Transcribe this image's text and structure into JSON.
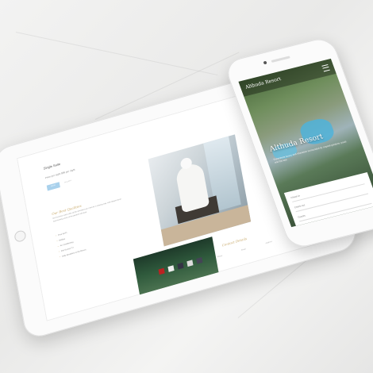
{
  "tablet": {
    "room_title": "Single Suite",
    "room_price": "Price per night $98 per night",
    "book_button": "BOOK",
    "secondary_link": "GALLERY",
    "feature_heading": "Our Best Qualities",
    "feature_text": "Our luxurious suites offer all the amenities you need for a relaxing stay, with elegant decor and stunning views of the gardens and pool.",
    "amenities": [
      "Free Wi-Fi",
      "Minibar",
      "Air Conditioning",
      "Flat Screen TV",
      "Daily Breakfast at the Resort"
    ],
    "contact_heading": "Contact Details",
    "contact_items": [
      "Phone",
      "Email",
      "Address"
    ]
  },
  "phone": {
    "logo": "Althuda Resort",
    "hero_title": "Althuda Resort",
    "hero_tagline": "Experience luxury and relaxation surrounded by tropical gardens, pools and the sea.",
    "form_fields": [
      "Check-in",
      "Check-out",
      "Guests"
    ]
  },
  "colors": {
    "accent_gold": "#c8a96a",
    "button_blue": "#a9d1ec",
    "pool_blue": "#4fb3d9"
  }
}
